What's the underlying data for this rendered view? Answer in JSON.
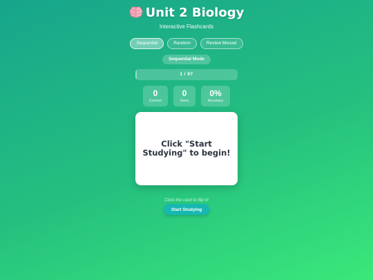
{
  "header": {
    "title": "Unit 2 Biology",
    "title_icon": "brain-icon",
    "subtitle": "Interactive Flashcards"
  },
  "modes": [
    {
      "label": "Sequential",
      "active": true
    },
    {
      "label": "Random",
      "active": false
    },
    {
      "label": "Review Missed",
      "active": false
    }
  ],
  "mode_badge": "Sequential Mode",
  "progress": {
    "text": "1 / 97",
    "current": 1,
    "total": 97
  },
  "stats": [
    {
      "value": "0",
      "label": "Correct"
    },
    {
      "value": "0",
      "label": "Seen"
    },
    {
      "value": "0%",
      "label": "Accuracy"
    }
  ],
  "card": {
    "text": "Click \"Start Studying\" to begin!"
  },
  "hint": "Click the card to flip it!",
  "start_button": "Start Studying",
  "colors": {
    "background_start": "#17a58c",
    "background_end": "#3ae87a",
    "start_button": "#16b8b0",
    "card_text": "#2d3440"
  }
}
